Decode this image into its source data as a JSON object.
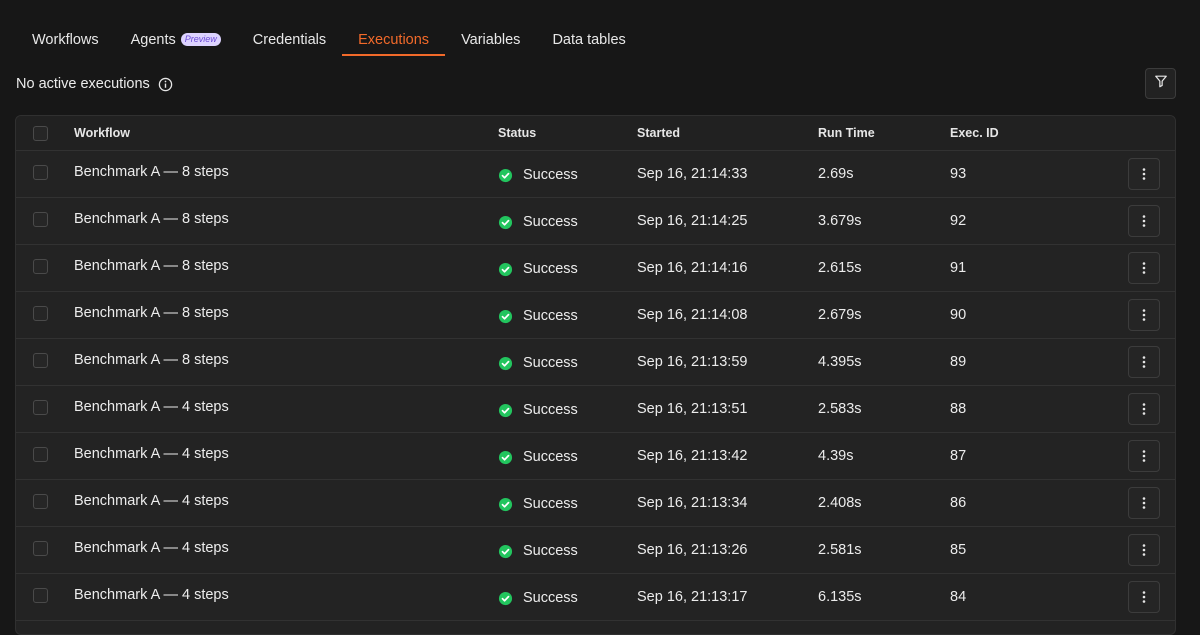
{
  "tabs": [
    {
      "label": "Workflows",
      "active": false
    },
    {
      "label": "Agents",
      "badge": "Preview",
      "active": false
    },
    {
      "label": "Credentials",
      "active": false
    },
    {
      "label": "Executions",
      "active": true
    },
    {
      "label": "Variables",
      "active": false
    },
    {
      "label": "Data tables",
      "active": false
    }
  ],
  "status_bar": {
    "text": "No active executions",
    "info_icon": "info-icon"
  },
  "toolbar": {
    "filter_icon": "filter-icon"
  },
  "table": {
    "headers": {
      "workflow": "Workflow",
      "status": "Status",
      "started": "Started",
      "run_time": "Run Time",
      "exec_id": "Exec. ID"
    },
    "rows": [
      {
        "workflow": "Benchmark A — 8 steps",
        "status": "Success",
        "started": "Sep 16, 21:14:33",
        "run_time": "2.69s",
        "exec_id": "93"
      },
      {
        "workflow": "Benchmark A — 8 steps",
        "status": "Success",
        "started": "Sep 16, 21:14:25",
        "run_time": "3.679s",
        "exec_id": "92"
      },
      {
        "workflow": "Benchmark A — 8 steps",
        "status": "Success",
        "started": "Sep 16, 21:14:16",
        "run_time": "2.615s",
        "exec_id": "91"
      },
      {
        "workflow": "Benchmark A — 8 steps",
        "status": "Success",
        "started": "Sep 16, 21:14:08",
        "run_time": "2.679s",
        "exec_id": "90"
      },
      {
        "workflow": "Benchmark A — 8 steps",
        "status": "Success",
        "started": "Sep 16, 21:13:59",
        "run_time": "4.395s",
        "exec_id": "89"
      },
      {
        "workflow": "Benchmark A — 4 steps",
        "status": "Success",
        "started": "Sep 16, 21:13:51",
        "run_time": "2.583s",
        "exec_id": "88"
      },
      {
        "workflow": "Benchmark A — 4 steps",
        "status": "Success",
        "started": "Sep 16, 21:13:42",
        "run_time": "4.39s",
        "exec_id": "87"
      },
      {
        "workflow": "Benchmark A — 4 steps",
        "status": "Success",
        "started": "Sep 16, 21:13:34",
        "run_time": "2.408s",
        "exec_id": "86"
      },
      {
        "workflow": "Benchmark A — 4 steps",
        "status": "Success",
        "started": "Sep 16, 21:13:26",
        "run_time": "2.581s",
        "exec_id": "85"
      },
      {
        "workflow": "Benchmark A — 4 steps",
        "status": "Success",
        "started": "Sep 16, 21:13:17",
        "run_time": "6.135s",
        "exec_id": "84"
      }
    ]
  },
  "colors": {
    "accent": "#f26a2a",
    "success": "#22c55e",
    "background": "#171717",
    "table_bg": "#232323"
  }
}
